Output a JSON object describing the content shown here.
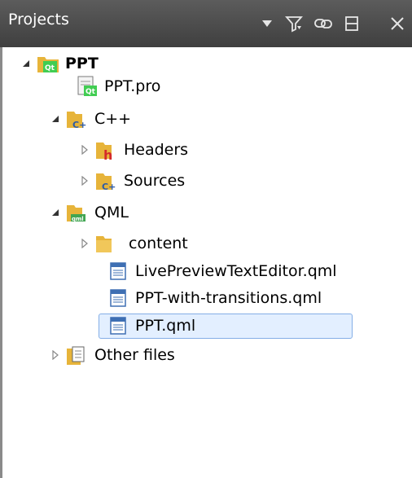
{
  "panel": {
    "title": "Projects"
  },
  "toolbar": {
    "dropdown_icon": "triangle-down-icon",
    "filter_icon": "filter-icon",
    "link_icon": "link-icon",
    "split_icon": "split-icon",
    "close_icon": "close-icon"
  },
  "tree": {
    "project": "PPT",
    "project_file": "PPT.pro",
    "cpp_folder": "C++",
    "headers": "Headers",
    "sources": "Sources",
    "qml_folder": "QML",
    "content": "content",
    "file_live_preview": "LivePreviewTextEditor.qml",
    "file_transitions": "PPT-with-transitions.qml",
    "file_main": "PPT.qml",
    "other_files": "Other files"
  },
  "colors": {
    "titlebar": "#4a4a4a",
    "selection_bg": "#e3efff",
    "selection_border": "#84aee6",
    "folder": "#e7b43a",
    "qt_green": "#41cd52"
  }
}
